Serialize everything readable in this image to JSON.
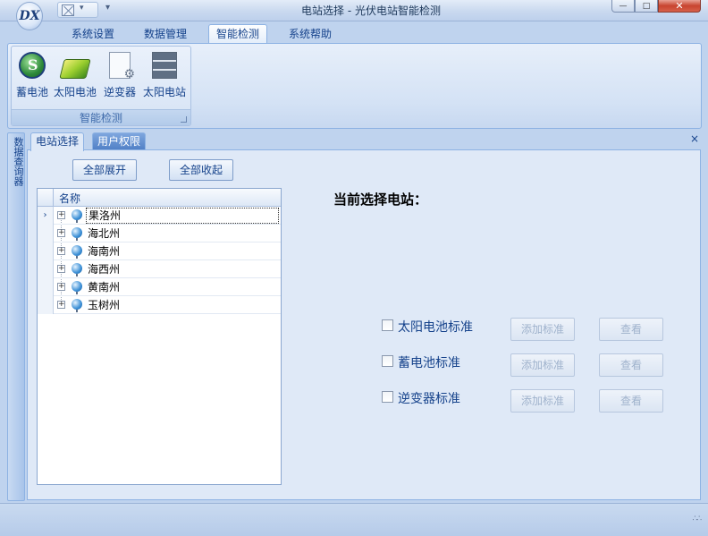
{
  "window": {
    "title": "电站选择 - 光伏电站智能检测",
    "app_logo_text": "DX",
    "controls": {
      "minimize": "—",
      "maximize": "□",
      "close": "✕"
    }
  },
  "ribbon": {
    "tabs": [
      "系统设置",
      "数据管理",
      "智能检测",
      "系统帮助"
    ],
    "active_tab": "智能检测",
    "group": {
      "title": "智能检测",
      "buttons": [
        {
          "label": "蓄电池",
          "icon": "battery-icon"
        },
        {
          "label": "太阳电池",
          "icon": "solar-cell-icon"
        },
        {
          "label": "逆变器",
          "icon": "inverter-icon"
        },
        {
          "label": "太阳电站",
          "icon": "solar-station-icon"
        }
      ]
    }
  },
  "dock": {
    "label": "数据查询器"
  },
  "doc_tabs": [
    "电站选择",
    "用户权限"
  ],
  "doc_close": "×",
  "panel": {
    "expand_all": "全部展开",
    "collapse_all": "全部收起",
    "tree_header": "名称",
    "tree_rows": [
      "果洛州",
      "海北州",
      "海南州",
      "海西州",
      "黄南州",
      "玉树州"
    ],
    "row_indicator": "›",
    "expander": "+",
    "current_station_label": "当前选择电站：",
    "standards": [
      {
        "label": "太阳电池标准",
        "checked": false,
        "add": "添加标准",
        "view": "查看"
      },
      {
        "label": "蓄电池标准",
        "checked": false,
        "add": "添加标准",
        "view": "查看"
      },
      {
        "label": "逆变器标准",
        "checked": false,
        "add": "添加标准",
        "view": "查看"
      }
    ]
  },
  "statusbar": {
    "grip": "∴∴"
  }
}
